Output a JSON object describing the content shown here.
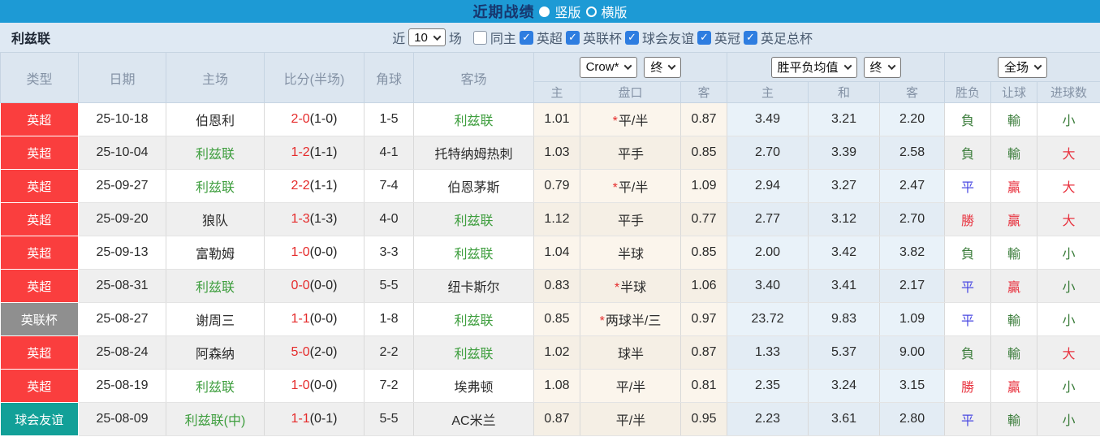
{
  "colors": {
    "topbar_blue": "#1d9ad5",
    "title_navy": "#17366e",
    "panel": "#dfe9f3",
    "header_bg": "#dce6f0",
    "header_text": "#8593a6",
    "red_badge": "#fa3e3e",
    "gray_badge": "#8f8f8f",
    "teal_badge": "#12a098",
    "score_red": "#e52b2b",
    "team_green": "#3e9e3e",
    "win_red": "#e8333f",
    "lose_green": "#3b7d3b",
    "draw_blue": "#4a49e2",
    "crow_bg": "#fbf5ec",
    "crow_bg_alt": "#f5efe5",
    "avg_bg": "#e9f2f9",
    "avg_bg_alt": "#e3ecf4",
    "row_alt": "#efefef",
    "checkbox_blue": "#2e7de0"
  },
  "topbar": {
    "title": "近期战绩",
    "radio_vertical": "竖版",
    "radio_horizontal": "横版",
    "selected": "竖版"
  },
  "filterbar": {
    "team": "利兹联",
    "recent_label": "近",
    "recent_count": "10",
    "matches_label": "场",
    "same_home_label": "同主",
    "same_home_checked": false,
    "check_glyph": "✓",
    "competitions": [
      {
        "label": "英超",
        "checked": true
      },
      {
        "label": "英联杯",
        "checked": true
      },
      {
        "label": "球会友谊",
        "checked": true
      },
      {
        "label": "英冠",
        "checked": true
      },
      {
        "label": "英足总杯",
        "checked": true
      }
    ]
  },
  "table": {
    "headers": {
      "type": "类型",
      "date": "日期",
      "home": "主场",
      "score": "比分(半场)",
      "corner": "角球",
      "away": "客场",
      "odds_company_select": "Crow*",
      "odds_stage_select": "终",
      "avg_metric_select": "胜平负均值",
      "avg_stage_select": "终",
      "scope_select": "全场",
      "sub": {
        "home": "主",
        "handicap": "盘口",
        "away": "客",
        "avg_home": "主",
        "avg_draw": "和",
        "avg_away": "客",
        "result": "胜负",
        "handicap_result": "让球",
        "goals": "进球数"
      }
    },
    "rows": [
      {
        "type": "英超",
        "type_class": "badge-red",
        "date": "25-10-18",
        "home": "伯恩利",
        "home_class": "",
        "score": "2-0",
        "half": "(1-0)",
        "corner": "1-5",
        "away": "利兹联",
        "away_class": "team-green",
        "crow_home": "1.01",
        "star": "*",
        "handicap": "平/半",
        "crow_away": "0.87",
        "avg_home": "3.49",
        "avg_draw": "3.21",
        "avg_away": "2.20",
        "result": "負",
        "result_class": "txt-green",
        "let_result": "輸",
        "let_class": "txt-green",
        "goals": "小",
        "goals_class": "txt-green"
      },
      {
        "type": "英超",
        "type_class": "badge-red",
        "date": "25-10-04",
        "home": "利兹联",
        "home_class": "team-green",
        "score": "1-2",
        "half": "(1-1)",
        "corner": "4-1",
        "away": "托特纳姆热刺",
        "away_class": "",
        "crow_home": "1.03",
        "star": "",
        "handicap": "平手",
        "crow_away": "0.85",
        "avg_home": "2.70",
        "avg_draw": "3.39",
        "avg_away": "2.58",
        "result": "負",
        "result_class": "txt-green",
        "let_result": "輸",
        "let_class": "txt-green",
        "goals": "大",
        "goals_class": "txt-red"
      },
      {
        "type": "英超",
        "type_class": "badge-red",
        "date": "25-09-27",
        "home": "利兹联",
        "home_class": "team-green",
        "score": "2-2",
        "half": "(1-1)",
        "corner": "7-4",
        "away": "伯恩茅斯",
        "away_class": "",
        "crow_home": "0.79",
        "star": "*",
        "handicap": "平/半",
        "crow_away": "1.09",
        "avg_home": "2.94",
        "avg_draw": "3.27",
        "avg_away": "2.47",
        "result": "平",
        "result_class": "txt-blue",
        "let_result": "贏",
        "let_class": "txt-red",
        "goals": "大",
        "goals_class": "txt-red"
      },
      {
        "type": "英超",
        "type_class": "badge-red",
        "date": "25-09-20",
        "home": "狼队",
        "home_class": "",
        "score": "1-3",
        "half": "(1-3)",
        "corner": "4-0",
        "away": "利兹联",
        "away_class": "team-green",
        "crow_home": "1.12",
        "star": "",
        "handicap": "平手",
        "crow_away": "0.77",
        "avg_home": "2.77",
        "avg_draw": "3.12",
        "avg_away": "2.70",
        "result": "勝",
        "result_class": "txt-red",
        "let_result": "贏",
        "let_class": "txt-red",
        "goals": "大",
        "goals_class": "txt-red"
      },
      {
        "type": "英超",
        "type_class": "badge-red",
        "date": "25-09-13",
        "home": "富勒姆",
        "home_class": "",
        "score": "1-0",
        "half": "(0-0)",
        "corner": "3-3",
        "away": "利兹联",
        "away_class": "team-green",
        "crow_home": "1.04",
        "star": "",
        "handicap": "半球",
        "crow_away": "0.85",
        "avg_home": "2.00",
        "avg_draw": "3.42",
        "avg_away": "3.82",
        "result": "負",
        "result_class": "txt-green",
        "let_result": "輸",
        "let_class": "txt-green",
        "goals": "小",
        "goals_class": "txt-green"
      },
      {
        "type": "英超",
        "type_class": "badge-red",
        "date": "25-08-31",
        "home": "利兹联",
        "home_class": "team-green",
        "score": "0-0",
        "half": "(0-0)",
        "corner": "5-5",
        "away": "纽卡斯尔",
        "away_class": "",
        "crow_home": "0.83",
        "star": "*",
        "handicap": "半球",
        "crow_away": "1.06",
        "avg_home": "3.40",
        "avg_draw": "3.41",
        "avg_away": "2.17",
        "result": "平",
        "result_class": "txt-blue",
        "let_result": "贏",
        "let_class": "txt-red",
        "goals": "小",
        "goals_class": "txt-green"
      },
      {
        "type": "英联杯",
        "type_class": "badge-gray",
        "date": "25-08-27",
        "home": "谢周三",
        "home_class": "",
        "score": "1-1",
        "half": "(0-0)",
        "corner": "1-8",
        "away": "利兹联",
        "away_class": "team-green",
        "crow_home": "0.85",
        "star": "*",
        "handicap": "两球半/三",
        "crow_away": "0.97",
        "avg_home": "23.72",
        "avg_draw": "9.83",
        "avg_away": "1.09",
        "result": "平",
        "result_class": "txt-blue",
        "let_result": "輸",
        "let_class": "txt-green",
        "goals": "小",
        "goals_class": "txt-green"
      },
      {
        "type": "英超",
        "type_class": "badge-red",
        "date": "25-08-24",
        "home": "阿森纳",
        "home_class": "",
        "score": "5-0",
        "half": "(2-0)",
        "corner": "2-2",
        "away": "利兹联",
        "away_class": "team-green",
        "crow_home": "1.02",
        "star": "",
        "handicap": "球半",
        "crow_away": "0.87",
        "avg_home": "1.33",
        "avg_draw": "5.37",
        "avg_away": "9.00",
        "result": "負",
        "result_class": "txt-green",
        "let_result": "輸",
        "let_class": "txt-green",
        "goals": "大",
        "goals_class": "txt-red"
      },
      {
        "type": "英超",
        "type_class": "badge-red",
        "date": "25-08-19",
        "home": "利兹联",
        "home_class": "team-green",
        "score": "1-0",
        "half": "(0-0)",
        "corner": "7-2",
        "away": "埃弗顿",
        "away_class": "",
        "crow_home": "1.08",
        "star": "",
        "handicap": "平/半",
        "crow_away": "0.81",
        "avg_home": "2.35",
        "avg_draw": "3.24",
        "avg_away": "3.15",
        "result": "勝",
        "result_class": "txt-red",
        "let_result": "贏",
        "let_class": "txt-red",
        "goals": "小",
        "goals_class": "txt-green"
      },
      {
        "type": "球会友谊",
        "type_class": "badge-teal",
        "date": "25-08-09",
        "home": "利兹联(中)",
        "home_class": "team-green",
        "score": "1-1",
        "half": "(0-1)",
        "corner": "5-5",
        "away": "AC米兰",
        "away_class": "",
        "crow_home": "0.87",
        "star": "",
        "handicap": "平/半",
        "crow_away": "0.95",
        "avg_home": "2.23",
        "avg_draw": "3.61",
        "avg_away": "2.80",
        "result": "平",
        "result_class": "txt-blue",
        "let_result": "輸",
        "let_class": "txt-green",
        "goals": "小",
        "goals_class": "txt-green"
      }
    ]
  }
}
